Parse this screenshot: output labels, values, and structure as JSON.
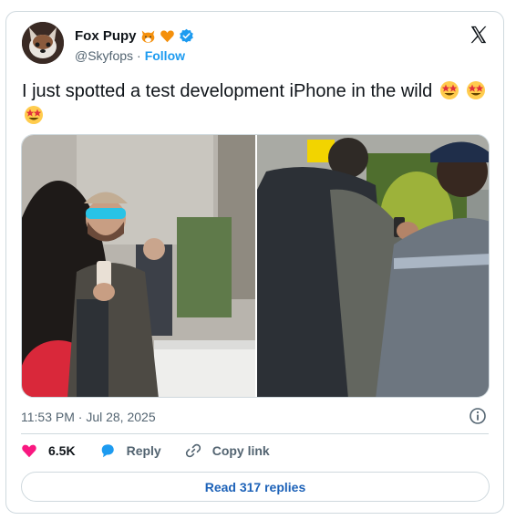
{
  "author": {
    "display_name": "Fox Pupy",
    "handle": "@Skyfops",
    "separator": "·",
    "follow_label": "Follow"
  },
  "tweet": {
    "text": "I just spotted a test development iPhone in the wild",
    "timestamp": "11:53 PM · Jul 28, 2025"
  },
  "actions": {
    "like_count": "6.5K",
    "reply_label": "Reply",
    "copy_link_label": "Copy link"
  },
  "read_replies_label": "Read 317 replies",
  "colors": {
    "accent": "#1d9bf0",
    "like": "#f91880",
    "verified": "#1d9bf0",
    "border": "#cfd9de",
    "muted": "#536471"
  },
  "icons": [
    "x-logo-icon",
    "verified-badge-icon",
    "fox-emoji-icon",
    "orange-heart-emoji-icon",
    "star-struck-emoji-icon",
    "info-icon",
    "heart-icon",
    "reply-bubble-icon",
    "link-icon"
  ]
}
